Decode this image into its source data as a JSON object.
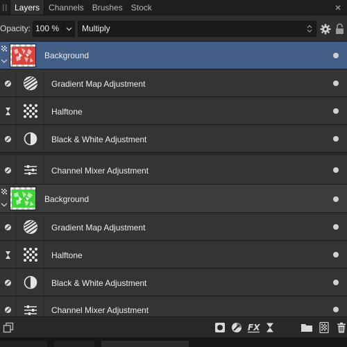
{
  "tabs": [
    {
      "label": "Layers",
      "active": true
    },
    {
      "label": "Channels",
      "active": false
    },
    {
      "label": "Brushes",
      "active": false
    },
    {
      "label": "Stock",
      "active": false
    }
  ],
  "toolbar": {
    "opacity_label": "Opacity:",
    "opacity_value": "100 %",
    "blend_mode": "Multiply"
  },
  "layers": [
    {
      "name": "Background",
      "type": "pixel-group",
      "thumb": "red",
      "selected": true,
      "icon": "pixel"
    },
    {
      "name": "Gradient Map Adjustment",
      "type": "adjustment",
      "icon": "gradient-map-icon",
      "small": "blend-range-icon"
    },
    {
      "name": "Halftone",
      "type": "filter",
      "icon": "halftone-icon",
      "small": "hourglass-icon"
    },
    {
      "name": "Black & White Adjustment",
      "type": "adjustment",
      "icon": "black-white-icon",
      "small": "blend-range-icon"
    },
    {
      "name": "Channel Mixer Adjustment",
      "type": "adjustment",
      "icon": "channel-mixer-icon",
      "small": "blend-range-icon"
    },
    {
      "name": "Background",
      "type": "pixel-group",
      "thumb": "green",
      "selected": false,
      "icon": "pixel"
    },
    {
      "name": "Gradient Map Adjustment",
      "type": "adjustment",
      "icon": "gradient-map-icon",
      "small": "blend-range-icon"
    },
    {
      "name": "Halftone",
      "type": "filter",
      "icon": "halftone-icon",
      "small": "hourglass-icon"
    },
    {
      "name": "Black & White Adjustment",
      "type": "adjustment",
      "icon": "black-white-icon",
      "small": "blend-range-icon"
    },
    {
      "name": "Channel Mixer Adjustment",
      "type": "adjustment",
      "icon": "channel-mixer-icon",
      "small": "blend-range-icon"
    }
  ],
  "colors": {
    "selected_row": "#435e86",
    "panel_bg": "#2e2e2e",
    "thumb_red": "#d8453e",
    "thumb_green": "#3fd23a"
  }
}
